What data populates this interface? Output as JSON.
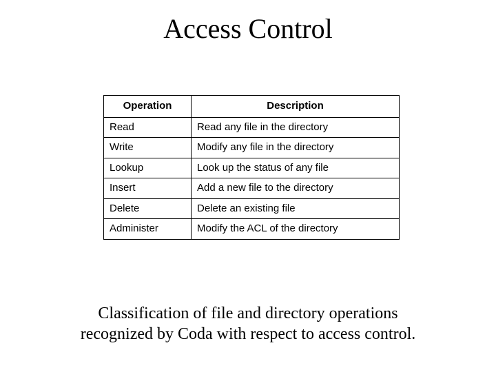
{
  "title": "Access Control",
  "table": {
    "headers": {
      "operation": "Operation",
      "description": "Description"
    },
    "rows": [
      {
        "operation": "Read",
        "description": "Read any file in the directory"
      },
      {
        "operation": "Write",
        "description": "Modify any file in the directory"
      },
      {
        "operation": "Lookup",
        "description": "Look up the status of any file"
      },
      {
        "operation": "Insert",
        "description": "Add a new file to the directory"
      },
      {
        "operation": "Delete",
        "description": "Delete an existing file"
      },
      {
        "operation": "Administer",
        "description": "Modify the ACL of the directory"
      }
    ]
  },
  "caption_line1": "Classification of file and directory operations",
  "caption_line2": "recognized by Coda with respect to access control."
}
